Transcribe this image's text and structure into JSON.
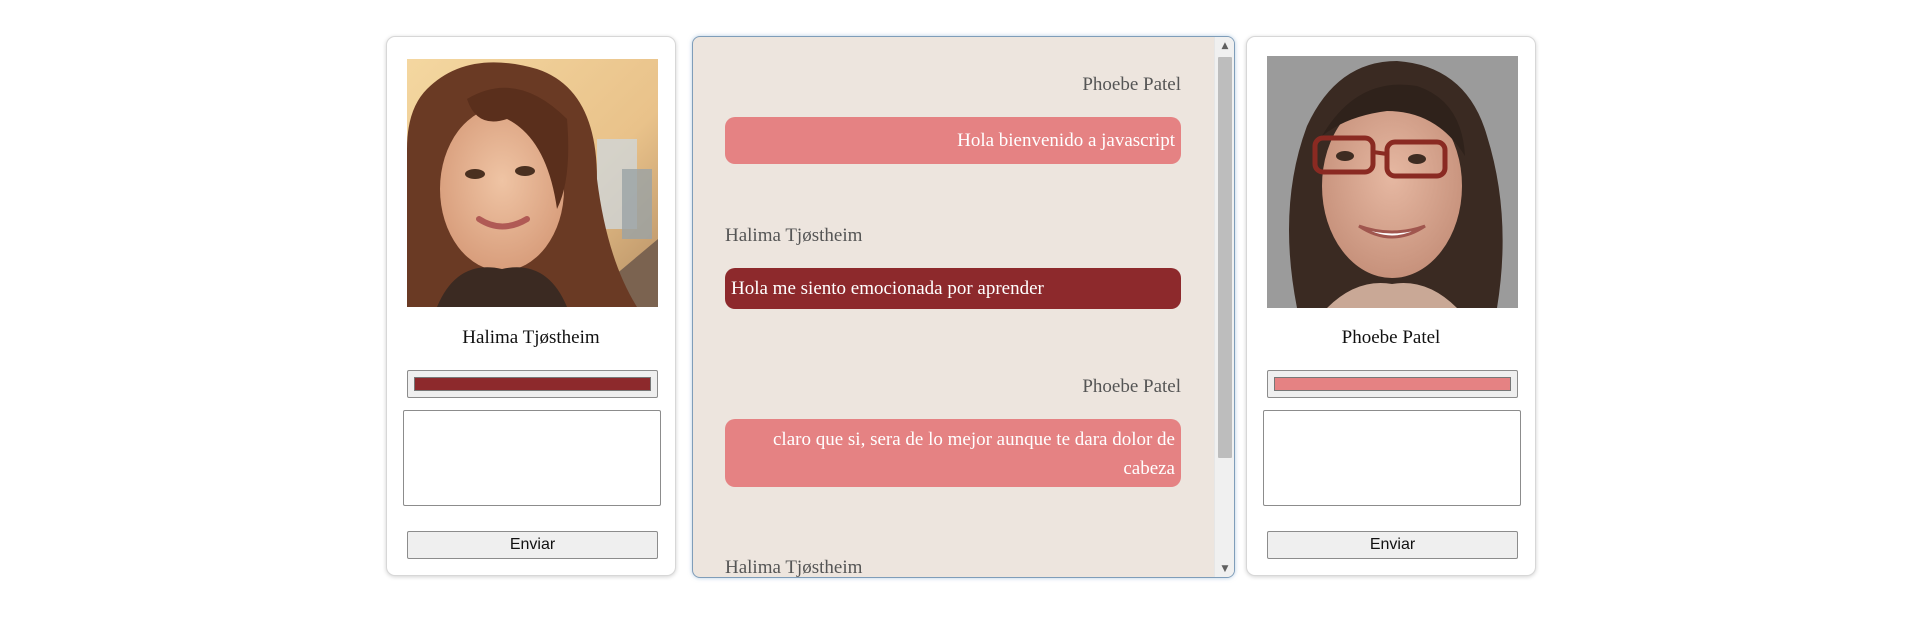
{
  "left_user": {
    "name": "Halima Tjøstheim",
    "color": "#8d292c",
    "message_value": "",
    "send_label": "Enviar",
    "avatar_icon": "woman-photo-avatar"
  },
  "right_user": {
    "name": "Phoebe Patel",
    "color": "#e58283",
    "message_value": "",
    "send_label": "Enviar",
    "avatar_icon": "woman-glasses-photo-avatar"
  },
  "chat": {
    "messages": [
      {
        "sender": "Phoebe Patel",
        "text": "Hola bienvenido a javascript",
        "color": "#e58283",
        "align": "right"
      },
      {
        "sender": "Halima Tjøstheim",
        "text": "Hola me siento emocionada por aprender",
        "color": "#8d292c",
        "align": "left"
      },
      {
        "sender": "Phoebe Patel",
        "text": "claro que si, sera de lo mejor aunque te dara dolor de cabeza",
        "color": "#e58283",
        "align": "right"
      },
      {
        "sender": "Halima Tjøstheim",
        "text": "",
        "color": "#8d292c",
        "align": "left"
      }
    ]
  },
  "colors": {
    "chat_background": "#ede5de",
    "card_background": "#ffffff"
  }
}
